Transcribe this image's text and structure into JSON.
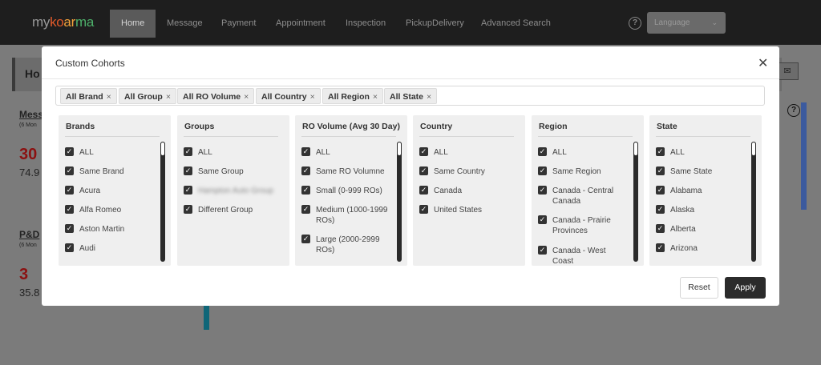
{
  "nav": {
    "logo": {
      "my": "my",
      "k1": "ko",
      "k2": "ar",
      "k3": "ma"
    },
    "items": [
      "Home",
      "Message",
      "Payment",
      "Appointment",
      "Inspection",
      "PickupDelivery",
      "Advanced Search"
    ],
    "help": "?",
    "language_placeholder": "Language"
  },
  "background": {
    "header_title": "Ho",
    "card1": {
      "title": "Mess",
      "sub": "(6 Mon",
      "big": "30",
      "small": "74.9"
    },
    "card2": {
      "title": "P&D",
      "sub": "(6 Mon",
      "big": "3",
      "small": "35.8"
    },
    "help": "?"
  },
  "modal": {
    "title": "Custom Cohorts",
    "chips": [
      "All Brand",
      "All Group",
      "All RO Volume",
      "All Country",
      "All Region",
      "All State"
    ],
    "panels": [
      {
        "title": "Brands",
        "items": [
          "ALL",
          "Same Brand",
          "Acura",
          "Alfa Romeo",
          "Aston Martin",
          "Audi"
        ]
      },
      {
        "title": "Groups",
        "items": [
          "ALL",
          "Same Group",
          "Hampton Auto Group",
          "Different Group"
        ]
      },
      {
        "title": "RO Volume (Avg 30 Day)",
        "items": [
          "ALL",
          "Same RO Volumne",
          "Small (0-999 ROs)",
          "Medium (1000-1999 ROs)",
          "Large (2000-2999 ROs)"
        ]
      },
      {
        "title": "Country",
        "items": [
          "ALL",
          "Same Country",
          "Canada",
          "United States"
        ]
      },
      {
        "title": "Region",
        "items": [
          "ALL",
          "Same Region",
          "Canada - Central Canada",
          "Canada - Prairie Provinces",
          "Canada - West Coast"
        ]
      },
      {
        "title": "State",
        "items": [
          "ALL",
          "Same State",
          "Alabama",
          "Alaska",
          "Alberta",
          "Arizona"
        ]
      }
    ],
    "reset_label": "Reset",
    "apply_label": "Apply"
  },
  "colors": {
    "accent_dark": "#2b2b2b",
    "bg_red": "#b01515",
    "bg_blue": "#3b5a9e"
  }
}
